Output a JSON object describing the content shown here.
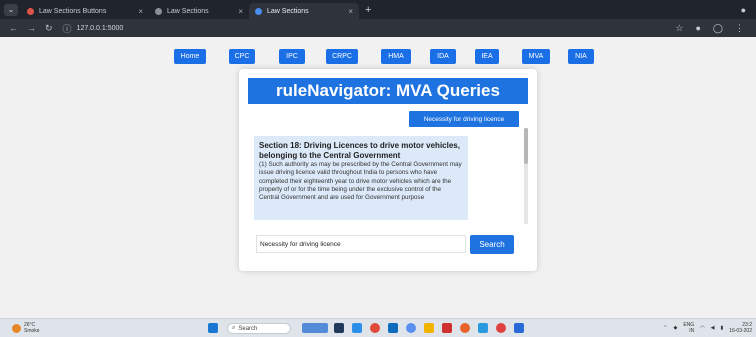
{
  "browser": {
    "tabs": [
      {
        "label": "Law Sections Buttons",
        "active": false,
        "color": "#e0554a"
      },
      {
        "label": "Law Sections",
        "active": false,
        "color": "#8b8f96"
      },
      {
        "label": "Law Sections",
        "active": true,
        "color": "#4a8df0"
      }
    ],
    "url": "127.0.0.1:5000"
  },
  "nav": {
    "buttons": [
      "Home",
      "CPC",
      "IPC",
      "CRPC",
      "HMA",
      "IDA",
      "IEA",
      "MVA",
      "NIA"
    ]
  },
  "main": {
    "title": "ruleNavigator: MVA Queries",
    "tag_button": "Necessity for driving licence",
    "result": {
      "heading": "Section 18: Driving Licences to drive motor vehicles, belonging to the Central Government",
      "body": "(1) Such authority as may be prescribed by the Central Government may issue driving licence valid throughout India to persons who have completed their eighteenth year to drive motor vehicles which are the property of or for the time being under the exclusive control of the Central Government and are used for Government purpose"
    },
    "query_value": "Necessity for driving licence",
    "search_label": "Search"
  },
  "taskbar": {
    "weather_temp": "26°C",
    "weather_desc": "Smoke",
    "search_label": "Search",
    "lang_line1": "ENG",
    "lang_line2": "IN",
    "time": "23:2",
    "date": "16-03-202"
  },
  "colors": {
    "accent": "#1e73e0",
    "result_bg": "#dce9f8"
  }
}
